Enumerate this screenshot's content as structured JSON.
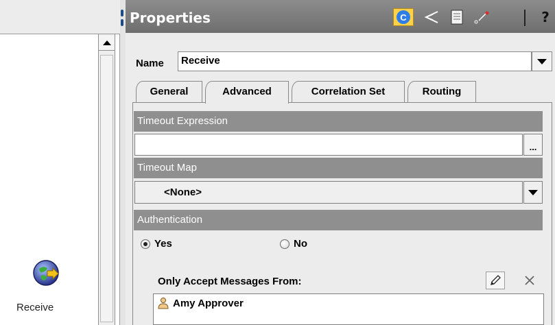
{
  "left_panel": {
    "node_label": "Receive"
  },
  "properties": {
    "title": "Properties",
    "toolbar": {
      "correlation_button_glyph": "C",
      "help_glyph": "?"
    },
    "name": {
      "label": "Name",
      "value": "Receive"
    },
    "tabs": [
      {
        "label": "General",
        "selected": false
      },
      {
        "label": "Advanced",
        "selected": true
      },
      {
        "label": "Correlation Set",
        "selected": false
      },
      {
        "label": "Routing",
        "selected": false
      }
    ],
    "timeout_expression": {
      "header": "Timeout Expression",
      "value": "",
      "browse_label": "..."
    },
    "timeout_map": {
      "header": "Timeout Map",
      "selected": "<None>"
    },
    "authentication": {
      "header": "Authentication",
      "options": [
        {
          "label": "Yes",
          "checked": true
        },
        {
          "label": "No",
          "checked": false
        }
      ]
    },
    "accept_messages": {
      "label": "Only Accept Messages From:",
      "items": [
        "Amy Approver"
      ]
    }
  },
  "icons": {
    "receive_node": "receive-globe-icon",
    "share": "share-icon",
    "document": "document-icon",
    "pen": "pen-icon",
    "edit": "pencil-icon",
    "delete": "close-icon",
    "user": "user-icon"
  },
  "colors": {
    "header_gray": "#7f7f7f",
    "section_gray": "#8f8f8f",
    "highlight_yellow": "#ffd24a",
    "accent_blue": "#2f7ee6"
  }
}
